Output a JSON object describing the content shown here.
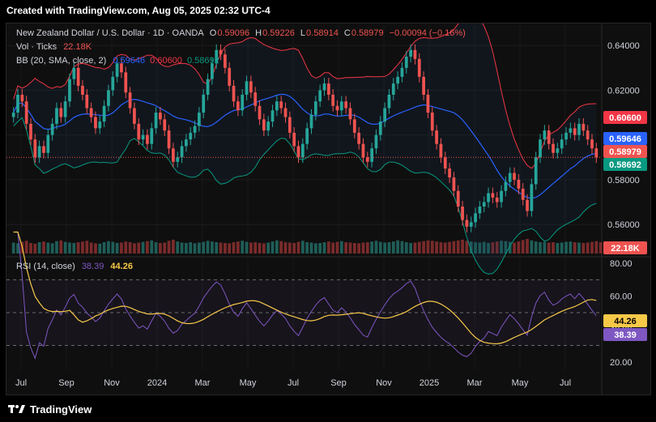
{
  "header": {
    "text": "Created with TradingView.com, Aug 05, 2025 02:32 UTC-4"
  },
  "footer": {
    "brand": "TradingView"
  },
  "legend": {
    "symbol": "New Zealand Dollar / U.S. Dollar · 1D · OANDA",
    "o_label": "O",
    "o_value": "0.59096",
    "h_label": "H",
    "h_value": "0.59226",
    "l_label": "L",
    "l_value": "0.58914",
    "c_label": "C",
    "c_value": "0.58979",
    "change": "−0.00094 (−0.16%)",
    "vol_label": "Vol · Ticks",
    "vol_value": "22.18K",
    "bb_label": "BB (20, SMA, close, 2)",
    "bb_basis": "0.59646",
    "bb_upper": "0.60600",
    "bb_lower": "0.58692",
    "rsi_label": "RSI (14, close)",
    "rsi_value": "38.39",
    "rsi_ma": "44.26"
  },
  "colors": {
    "up": "#26a69a",
    "down": "#ef5350",
    "basis": "#2962ff",
    "upper": "#f23645",
    "lower": "#089981",
    "rsi": "#7e57c2",
    "rsi_ma": "#f7c948",
    "text": "#d1d4dc"
  },
  "price_badges": {
    "upper": "0.60600",
    "basis": "0.59646",
    "close": "0.58979",
    "lower": "0.58692",
    "volume": "22.18K"
  },
  "rsi_badges": {
    "ma": "44.26",
    "rsi": "38.39"
  },
  "chart_data": [
    {
      "type": "candlestick",
      "name": "price",
      "y_ticks": [
        "0.64000",
        "0.62000",
        "0.60000",
        "0.58000",
        "0.56000"
      ],
      "y_tick_values": [
        0.64,
        0.62,
        0.6,
        0.58,
        0.56
      ],
      "ylim": [
        0.547,
        0.6455
      ],
      "x_ticks": [
        "Jul",
        "Sep",
        "Nov",
        "2024",
        "Mar",
        "May",
        "Jul",
        "Sep",
        "Nov",
        "2025",
        "Mar",
        "May",
        "Jul"
      ],
      "closes": [
        0.61,
        0.618,
        0.615,
        0.605,
        0.598,
        0.59,
        0.595,
        0.592,
        0.6,
        0.605,
        0.612,
        0.608,
        0.615,
        0.625,
        0.63,
        0.622,
        0.618,
        0.612,
        0.608,
        0.603,
        0.606,
        0.613,
        0.62,
        0.626,
        0.632,
        0.628,
        0.619,
        0.612,
        0.605,
        0.598,
        0.6,
        0.596,
        0.603,
        0.61,
        0.607,
        0.602,
        0.594,
        0.588,
        0.59,
        0.595,
        0.598,
        0.601,
        0.604,
        0.61,
        0.618,
        0.625,
        0.632,
        0.638,
        0.636,
        0.63,
        0.622,
        0.615,
        0.611,
        0.618,
        0.624,
        0.619,
        0.613,
        0.607,
        0.602,
        0.606,
        0.611,
        0.615,
        0.612,
        0.608,
        0.601,
        0.595,
        0.59,
        0.596,
        0.603,
        0.609,
        0.615,
        0.62,
        0.623,
        0.618,
        0.613,
        0.611,
        0.615,
        0.612,
        0.607,
        0.601,
        0.596,
        0.59,
        0.588,
        0.594,
        0.6,
        0.606,
        0.612,
        0.618,
        0.623,
        0.626,
        0.63,
        0.635,
        0.638,
        0.634,
        0.626,
        0.618,
        0.61,
        0.602,
        0.596,
        0.59,
        0.585,
        0.581,
        0.575,
        0.568,
        0.562,
        0.559,
        0.561,
        0.565,
        0.568,
        0.57,
        0.574,
        0.572,
        0.57,
        0.575,
        0.579,
        0.583,
        0.58,
        0.576,
        0.571,
        0.566,
        0.578,
        0.59,
        0.598,
        0.602,
        0.596,
        0.592,
        0.594,
        0.598,
        0.601,
        0.603,
        0.6,
        0.605,
        0.602,
        0.598,
        0.594,
        0.59
      ],
      "volumes": [
        30,
        28,
        32,
        35,
        29,
        27,
        31,
        33,
        30,
        28,
        34,
        36,
        32,
        30,
        29,
        31,
        33,
        35,
        30,
        28,
        27,
        31,
        34,
        32,
        29,
        30,
        33,
        31,
        28,
        30,
        32,
        34,
        36,
        31,
        29,
        30,
        35,
        38,
        33,
        30,
        29,
        31,
        28,
        30,
        32,
        35,
        33,
        31,
        30,
        29,
        28,
        31,
        33,
        35,
        32,
        30,
        31,
        29,
        28,
        30,
        33,
        36,
        34,
        31,
        30,
        29,
        32,
        35,
        31,
        30,
        28,
        29,
        31,
        33,
        30,
        32,
        34,
        31,
        30,
        29,
        28,
        30,
        31,
        33,
        35,
        32,
        30,
        31,
        33,
        36,
        34,
        31,
        29,
        30,
        32,
        34,
        36,
        35,
        33,
        31,
        30,
        32,
        34,
        36,
        38,
        35,
        33,
        31,
        30,
        32,
        29,
        31,
        33,
        35,
        34,
        32,
        30,
        33,
        37,
        40,
        36,
        33,
        31,
        32,
        30,
        31,
        29,
        30,
        32,
        33,
        31,
        30,
        29,
        30,
        32,
        34,
        31,
        33
      ],
      "rsi_ticks": [
        "80.00",
        "60.00",
        "40.00",
        "20.00"
      ],
      "rsi_tick_values": [
        80,
        60,
        40,
        20
      ],
      "rsi_bands": [
        70,
        50,
        30
      ],
      "rsi_ylim": [
        15,
        82
      ]
    }
  ]
}
